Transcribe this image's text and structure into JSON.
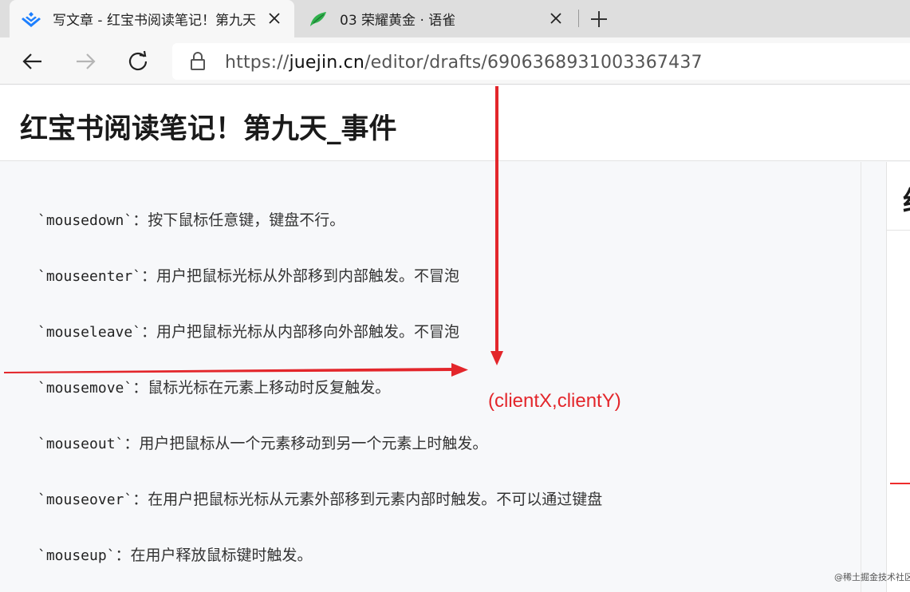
{
  "browser": {
    "tabs": [
      {
        "title": "写文章 - 红宝书阅读笔记！第九天",
        "icon": "juejin-logo-icon",
        "active": true
      },
      {
        "title": "03 荣耀黄金 · 语雀",
        "icon": "yuque-bird-icon",
        "active": false
      }
    ],
    "address": {
      "scheme": "https://",
      "host": "juejin.cn",
      "path": "/editor/drafts/6906368931003367437"
    }
  },
  "editor": {
    "title": "红宝书阅读笔记！第九天_事件",
    "lines": [
      {
        "code": "`mousedown`",
        "text": "：按下鼠标任意键，键盘不行。"
      },
      {
        "code": "`mouseenter`",
        "text": "：用户把鼠标光标从外部移到内部触发。不冒泡"
      },
      {
        "code": "`mouseleave`",
        "text": "：用户把鼠标光标从内部移向外部触发。不冒泡"
      },
      {
        "code": "`mousemove`",
        "text": "：鼠标光标在元素上移动时反复触发。"
      },
      {
        "code": "`mouseout`",
        "text": "：用户把鼠标从一个元素移动到另一个元素上时触发。"
      },
      {
        "code": "`mouseover`",
        "text": "：在用户把鼠标光标从元素外部移到元素内部时触发。不可以通过键盘"
      },
      {
        "code": "`mouseup`",
        "text": "：在用户释放鼠标键时触发。"
      }
    ]
  },
  "preview": {
    "glyph": "红"
  },
  "annotation": {
    "label": "(clientX,clientY)",
    "color": "#e3262b"
  },
  "watermark": "@稀土掘金技术社区"
}
